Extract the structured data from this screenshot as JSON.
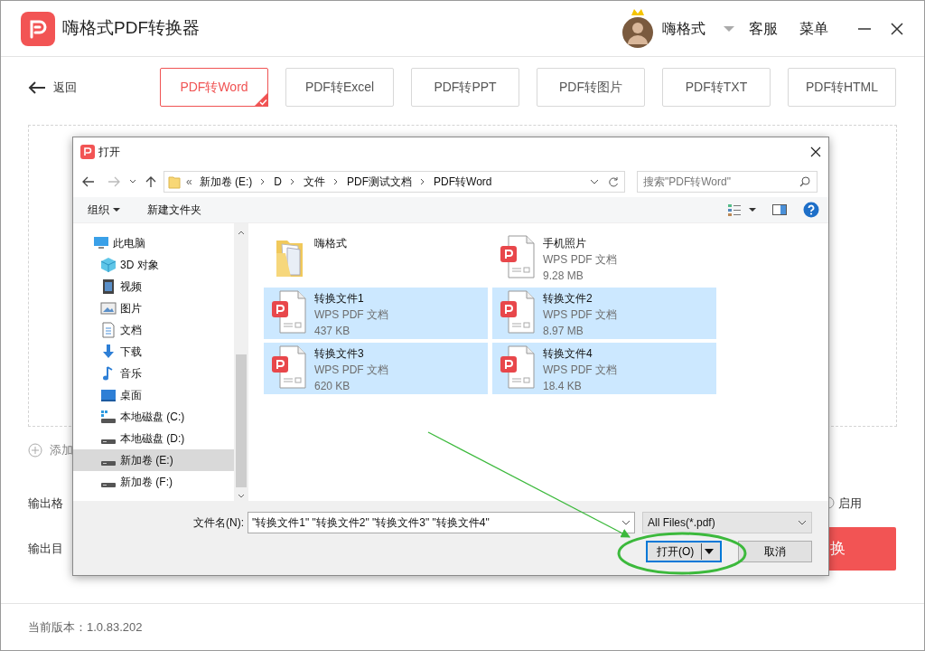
{
  "app": {
    "title": "嗨格式PDF转换器",
    "user": "嗨格式",
    "menu": [
      "客服",
      "菜单"
    ]
  },
  "back": "返回",
  "tabs": [
    {
      "label": "PDF转Word",
      "selected": true
    },
    {
      "label": "PDF转Excel",
      "selected": false
    },
    {
      "label": "PDF转PPT",
      "selected": false
    },
    {
      "label": "PDF转图片",
      "selected": false
    },
    {
      "label": "PDF转TXT",
      "selected": false
    },
    {
      "label": "PDF转HTML",
      "selected": false
    }
  ],
  "background": {
    "add_label": "添加",
    "format_label": "输出格",
    "enable": {
      "label": "启用",
      "checked": false
    },
    "dir_label": "输出目",
    "convert_button": "换",
    "version": "当前版本：1.0.83.202"
  },
  "dialog": {
    "title": "打开",
    "overflow": "«",
    "breadcrumb": [
      "新加卷 (E:)",
      "D",
      "文件",
      "PDF测试文档",
      "PDF转Word"
    ],
    "search": {
      "placeholder": "搜索\"PDF转Word\""
    },
    "toolbar": [
      "组织",
      "新建文件夹"
    ],
    "nav": [
      {
        "label": "此电脑",
        "kind": "computer",
        "selected": false,
        "children": [
          {
            "label": "3D 对象",
            "kind": "cube",
            "selected": false
          },
          {
            "label": "视频",
            "kind": "video",
            "selected": false
          },
          {
            "label": "图片",
            "kind": "picture",
            "selected": false
          },
          {
            "label": "文档",
            "kind": "document",
            "selected": false
          },
          {
            "label": "下载",
            "kind": "download",
            "selected": false
          },
          {
            "label": "音乐",
            "kind": "music",
            "selected": false
          },
          {
            "label": "桌面",
            "kind": "desktop",
            "selected": false
          },
          {
            "label": "本地磁盘 (C:)",
            "kind": "system-drive",
            "selected": false
          },
          {
            "label": "本地磁盘 (D:)",
            "kind": "drive",
            "selected": false
          },
          {
            "label": "新加卷 (E:)",
            "kind": "drive",
            "selected": true
          },
          {
            "label": "新加卷 (F:)",
            "kind": "drive",
            "selected": false
          }
        ]
      }
    ],
    "files": [
      {
        "name": "嗨格式",
        "kind": "folder",
        "selected": false
      },
      {
        "name": "手机照片",
        "kind": "pdf",
        "type": "WPS PDF 文档",
        "size": "9.28 MB",
        "selected": false
      },
      {
        "name": "转换文件1",
        "kind": "pdf",
        "type": "WPS PDF 文档",
        "size": "437 KB",
        "selected": true
      },
      {
        "name": "转换文件2",
        "kind": "pdf",
        "type": "WPS PDF 文档",
        "size": "8.97 MB",
        "selected": true
      },
      {
        "name": "转换文件3",
        "kind": "pdf",
        "type": "WPS PDF 文档",
        "size": "620 KB",
        "selected": true
      },
      {
        "name": "转换文件4",
        "kind": "pdf",
        "type": "WPS PDF 文档",
        "size": "18.4 KB",
        "selected": true
      }
    ],
    "filename": {
      "label": "文件名(N):",
      "value": "\"转换文件1\" \"转换文件2\" \"转换文件3\" \"转换文件4\""
    },
    "filetype": "All Files(*.pdf)",
    "buttons": {
      "open": "打开(O)",
      "cancel": "取消"
    }
  }
}
